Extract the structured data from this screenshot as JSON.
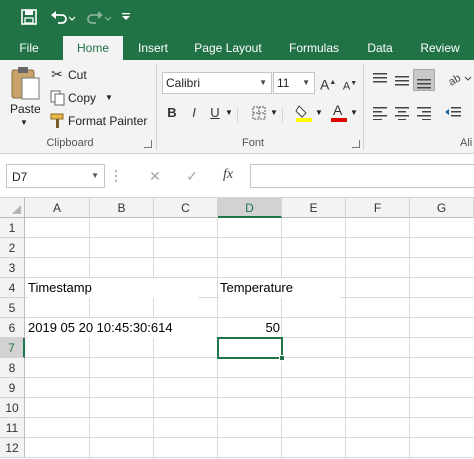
{
  "qat": {
    "save_icon": "save-icon",
    "undo_icon": "undo-icon",
    "redo_icon": "redo-icon",
    "customize_icon": "customize-qat-icon"
  },
  "tabs": [
    "File",
    "Home",
    "Insert",
    "Page Layout",
    "Formulas",
    "Data",
    "Review"
  ],
  "active_tab": "Home",
  "colors": {
    "brand": "#217346",
    "ribbon": "#f3f3f3"
  },
  "ribbon": {
    "clipboard": {
      "paste_label": "Paste",
      "cut_label": "Cut",
      "copy_label": "Copy",
      "format_painter_label": "Format Painter",
      "group_label": "Clipboard"
    },
    "font": {
      "font_name": "Calibri",
      "font_size": "11",
      "bold": "B",
      "italic": "I",
      "underline": "U",
      "group_label": "Font",
      "grow": "A",
      "shrink": "A",
      "font_color": "A"
    },
    "alignment": {
      "group_label_partial": "Ali"
    }
  },
  "formula_bar": {
    "name_box": "D7",
    "cancel_glyph": "✕",
    "enter_glyph": "✓",
    "fx_label": "fx",
    "formula_value": ""
  },
  "sheet": {
    "columns": [
      "A",
      "B",
      "C",
      "D",
      "E",
      "F",
      "G"
    ],
    "rows": [
      "1",
      "2",
      "3",
      "4",
      "5",
      "6",
      "7",
      "8",
      "9",
      "10",
      "11",
      "12"
    ],
    "selected_cell": "D7",
    "cells": {
      "A4": "Timestamp",
      "D4": "Temperature",
      "A6": "2019 05 20 10:45:30:614",
      "D6": "50"
    }
  }
}
